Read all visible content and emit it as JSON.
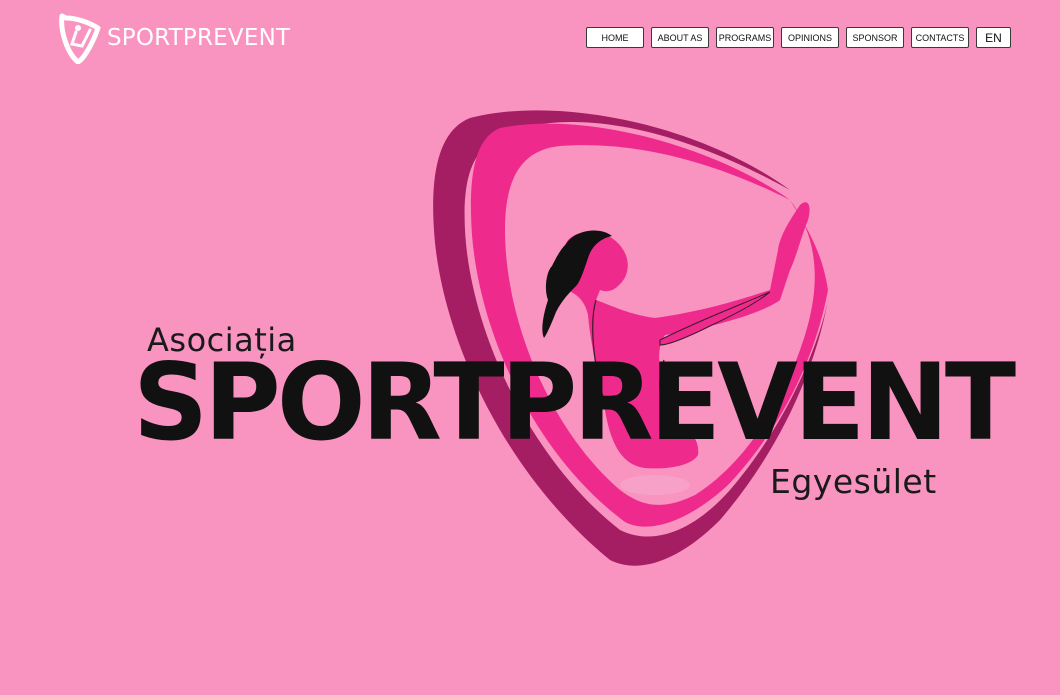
{
  "brand": {
    "name": "SPORTPREVENT",
    "icon": "sportprevent-logo-icon"
  },
  "nav": {
    "items": [
      {
        "label": "HOME"
      },
      {
        "label": "ABOUT AS"
      },
      {
        "label": "PROGRAMS"
      },
      {
        "label": "OPINIONS"
      },
      {
        "label": "SPONSOR"
      },
      {
        "label": "CONTACTS"
      }
    ],
    "language": "EN"
  },
  "hero": {
    "line1": "Asociația",
    "line2": "SPORTPREVENT",
    "line3": "Egyesület"
  },
  "colors": {
    "background": "#f993c0",
    "brand_pink": "#ee2a8c",
    "brand_dark_pink": "#a51d63",
    "text": "#111111"
  }
}
